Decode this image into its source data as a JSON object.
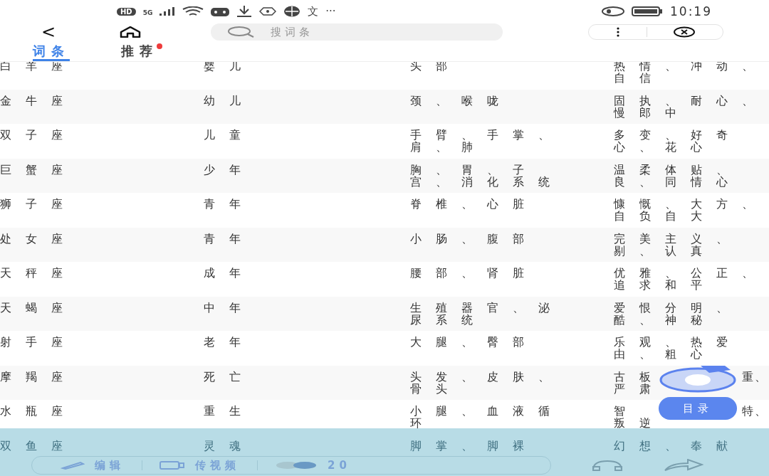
{
  "status_bar": {
    "hd": "HD",
    "network": "5G",
    "translate": "文",
    "more": "···",
    "time": "10:19"
  },
  "nav": {
    "back": "<",
    "search": {
      "placeholder": "搜词条"
    }
  },
  "tabs": [
    {
      "label": "词条",
      "selected": true,
      "badge": false
    },
    {
      "label": "推荐",
      "selected": false,
      "badge": true
    }
  ],
  "rows": [
    {
      "sign": "白羊座",
      "age": "婴儿",
      "body": [
        "头部"
      ],
      "traits": [
        "热情、冲动、",
        "自信"
      ]
    },
    {
      "sign": "金牛座",
      "age": "幼儿",
      "body": [
        "颈、喉咙"
      ],
      "traits": [
        "固执、耐心、",
        "慢郎中"
      ]
    },
    {
      "sign": "双子座",
      "age": "儿童",
      "body": [
        "手臂、手掌、",
        "肩、肺"
      ],
      "traits": [
        "多变、好奇",
        "心、花心"
      ]
    },
    {
      "sign": "巨蟹座",
      "age": "少年",
      "body": [
        "胸、胃、子",
        "宫、消化系统"
      ],
      "traits": [
        "温柔体贴、",
        "良、同情心"
      ]
    },
    {
      "sign": "狮子座",
      "age": "青年",
      "body": [
        "脊椎、心脏"
      ],
      "traits": [
        "慷慨、大方、",
        "自负自大"
      ]
    },
    {
      "sign": "处女座",
      "age": "青年",
      "body": [
        "小肠、腹部"
      ],
      "traits": [
        "完美主义、",
        "剔、认真"
      ]
    },
    {
      "sign": "天秤座",
      "age": "成年",
      "body": [
        "腰部、肾脏"
      ],
      "traits": [
        "优雅、公正、",
        "追求和平"
      ]
    },
    {
      "sign": "天蝎座",
      "age": "中年",
      "body": [
        "生殖器官、泌",
        "尿系统"
      ],
      "traits": [
        "爱恨分明、",
        "酷、神秘"
      ]
    },
    {
      "sign": "射手座",
      "age": "老年",
      "body": [
        "大腿、臀部"
      ],
      "traits": [
        "乐观、热爱",
        "由、粗心"
      ]
    },
    {
      "sign": "摩羯座",
      "age": "死亡",
      "body": [
        "头发、皮肤、",
        "骨头"
      ],
      "traits": [
        "古板",
        "严肃"
      ],
      "tail": "重、"
    },
    {
      "sign": "水瓶座",
      "age": "重生",
      "body": [
        "小腿、血液循",
        "环"
      ],
      "traits": [
        "智",
        "叛逆"
      ],
      "tail": "特、"
    },
    {
      "sign": "双鱼座",
      "age": "灵魂",
      "body": [
        "脚掌、脚裸"
      ],
      "traits": [
        "幻想、奉献"
      ]
    }
  ],
  "floating": {
    "toc_label": "目录"
  },
  "bottom_bar": {
    "edit": "编辑",
    "video": "传视频",
    "count": "20"
  }
}
